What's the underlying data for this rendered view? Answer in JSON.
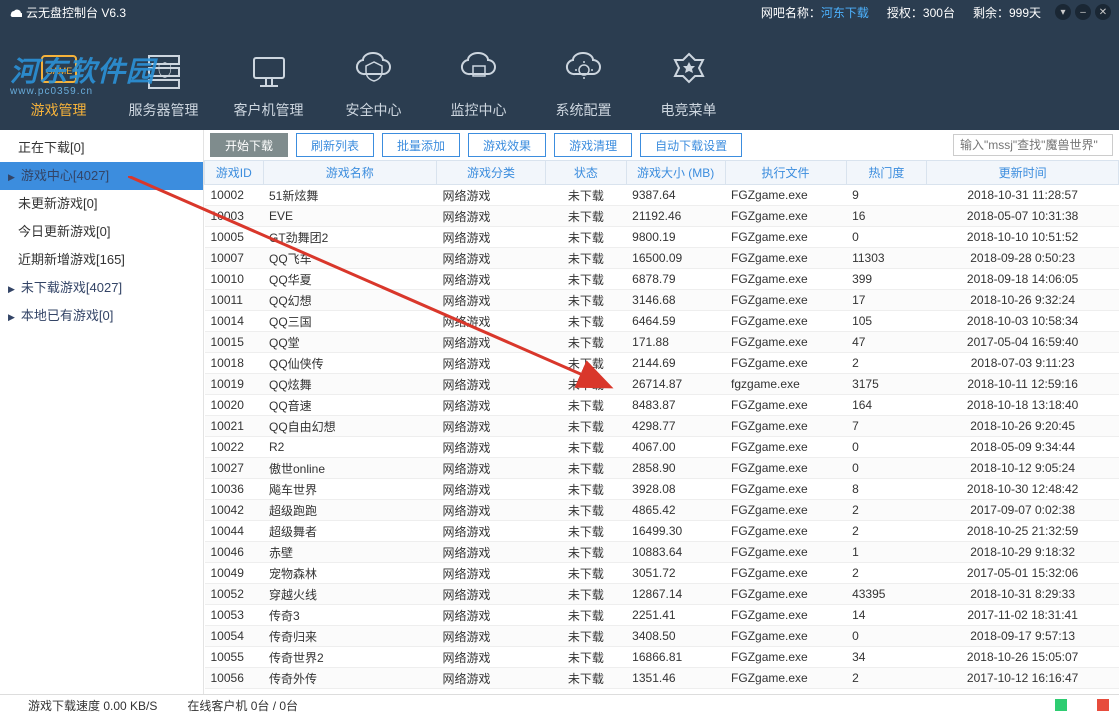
{
  "title": "云无盘控制台 V6.3",
  "header": {
    "bar_label": "网吧名称：",
    "bar_name": "河东下载",
    "auth_label": "授权：",
    "auth_val": "300台",
    "remain_label": "剩余：",
    "remain_val": "999天"
  },
  "nav": [
    {
      "label": "游戏管理",
      "active": true
    },
    {
      "label": "服务器管理"
    },
    {
      "label": "客户机管理"
    },
    {
      "label": "安全中心"
    },
    {
      "label": "监控中心"
    },
    {
      "label": "系统配置"
    },
    {
      "label": "电竞菜单"
    }
  ],
  "sidebar": [
    {
      "label": "正在下载[0]"
    },
    {
      "label": "游戏中心[4027]",
      "sel": true,
      "sub": true
    },
    {
      "label": "未更新游戏[0]"
    },
    {
      "label": "今日更新游戏[0]"
    },
    {
      "label": "近期新增游戏[165]"
    },
    {
      "label": "未下载游戏[4027]",
      "sub": true
    },
    {
      "label": "本地已有游戏[0]",
      "sub": true
    }
  ],
  "toolbar": {
    "start": "开始下载",
    "refresh": "刷新列表",
    "batch": "批量添加",
    "fx": "游戏效果",
    "clean": "游戏清理",
    "auto": "自动下载设置",
    "search_ph": "输入\"mssj\"查找\"魔兽世界\""
  },
  "columns": {
    "id": "游戏ID",
    "name": "游戏名称",
    "cat": "游戏分类",
    "st": "状态",
    "size": "游戏大小 (MB)",
    "exe": "执行文件",
    "hot": "热门度",
    "time": "更新时间"
  },
  "rows": [
    {
      "id": "10002",
      "name": "51新炫舞",
      "cat": "网络游戏",
      "st": "未下载",
      "size": "9387.64",
      "exe": "FGZgame.exe",
      "hot": "9",
      "time": "2018-10-31 11:28:57"
    },
    {
      "id": "10003",
      "name": "EVE",
      "cat": "网络游戏",
      "st": "未下载",
      "size": "21192.46",
      "exe": "FGZgame.exe",
      "hot": "16",
      "time": "2018-05-07 10:31:38"
    },
    {
      "id": "10005",
      "name": "GT劲舞团2",
      "cat": "网络游戏",
      "st": "未下载",
      "size": "9800.19",
      "exe": "FGZgame.exe",
      "hot": "0",
      "time": "2018-10-10 10:51:52"
    },
    {
      "id": "10007",
      "name": "QQ飞车",
      "cat": "网络游戏",
      "st": "未下载",
      "size": "16500.09",
      "exe": "FGZgame.exe",
      "hot": "11303",
      "time": "2018-09-28 0:50:23"
    },
    {
      "id": "10010",
      "name": "QQ华夏",
      "cat": "网络游戏",
      "st": "未下载",
      "size": "6878.79",
      "exe": "FGZgame.exe",
      "hot": "399",
      "time": "2018-09-18 14:06:05"
    },
    {
      "id": "10011",
      "name": "QQ幻想",
      "cat": "网络游戏",
      "st": "未下载",
      "size": "3146.68",
      "exe": "FGZgame.exe",
      "hot": "17",
      "time": "2018-10-26 9:32:24"
    },
    {
      "id": "10014",
      "name": "QQ三国",
      "cat": "网络游戏",
      "st": "未下载",
      "size": "6464.59",
      "exe": "FGZgame.exe",
      "hot": "105",
      "time": "2018-10-03 10:58:34"
    },
    {
      "id": "10015",
      "name": "QQ堂",
      "cat": "网络游戏",
      "st": "未下载",
      "size": "171.88",
      "exe": "FGZgame.exe",
      "hot": "47",
      "time": "2017-05-04 16:59:40"
    },
    {
      "id": "10018",
      "name": "QQ仙侠传",
      "cat": "网络游戏",
      "st": "未下载",
      "size": "2144.69",
      "exe": "FGZgame.exe",
      "hot": "2",
      "time": "2018-07-03 9:11:23"
    },
    {
      "id": "10019",
      "name": "QQ炫舞",
      "cat": "网络游戏",
      "st": "未下载",
      "size": "26714.87",
      "exe": "fgzgame.exe",
      "hot": "3175",
      "time": "2018-10-11 12:59:16"
    },
    {
      "id": "10020",
      "name": "QQ音速",
      "cat": "网络游戏",
      "st": "未下载",
      "size": "8483.87",
      "exe": "FGZgame.exe",
      "hot": "164",
      "time": "2018-10-18 13:18:40"
    },
    {
      "id": "10021",
      "name": "QQ自由幻想",
      "cat": "网络游戏",
      "st": "未下载",
      "size": "4298.77",
      "exe": "FGZgame.exe",
      "hot": "7",
      "time": "2018-10-26 9:20:45"
    },
    {
      "id": "10022",
      "name": "R2",
      "cat": "网络游戏",
      "st": "未下载",
      "size": "4067.00",
      "exe": "FGZgame.exe",
      "hot": "0",
      "time": "2018-05-09 9:34:44"
    },
    {
      "id": "10027",
      "name": "傲世online",
      "cat": "网络游戏",
      "st": "未下载",
      "size": "2858.90",
      "exe": "FGZgame.exe",
      "hot": "0",
      "time": "2018-10-12 9:05:24"
    },
    {
      "id": "10036",
      "name": "飚车世界",
      "cat": "网络游戏",
      "st": "未下载",
      "size": "3928.08",
      "exe": "FGZgame.exe",
      "hot": "8",
      "time": "2018-10-30 12:48:42"
    },
    {
      "id": "10042",
      "name": "超级跑跑",
      "cat": "网络游戏",
      "st": "未下载",
      "size": "4865.42",
      "exe": "FGZgame.exe",
      "hot": "2",
      "time": "2017-09-07 0:02:38"
    },
    {
      "id": "10044",
      "name": "超级舞者",
      "cat": "网络游戏",
      "st": "未下载",
      "size": "16499.30",
      "exe": "FGZgame.exe",
      "hot": "2",
      "time": "2018-10-25 21:32:59"
    },
    {
      "id": "10046",
      "name": "赤壁",
      "cat": "网络游戏",
      "st": "未下载",
      "size": "10883.64",
      "exe": "FGZgame.exe",
      "hot": "1",
      "time": "2018-10-29 9:18:32"
    },
    {
      "id": "10049",
      "name": "宠物森林",
      "cat": "网络游戏",
      "st": "未下载",
      "size": "3051.72",
      "exe": "FGZgame.exe",
      "hot": "2",
      "time": "2017-05-01 15:32:06"
    },
    {
      "id": "10052",
      "name": "穿越火线",
      "cat": "网络游戏",
      "st": "未下载",
      "size": "12867.14",
      "exe": "FGZgame.exe",
      "hot": "43395",
      "time": "2018-10-31 8:29:33"
    },
    {
      "id": "10053",
      "name": "传奇3",
      "cat": "网络游戏",
      "st": "未下载",
      "size": "2251.41",
      "exe": "FGZgame.exe",
      "hot": "14",
      "time": "2017-11-02 18:31:41"
    },
    {
      "id": "10054",
      "name": "传奇归来",
      "cat": "网络游戏",
      "st": "未下载",
      "size": "3408.50",
      "exe": "FGZgame.exe",
      "hot": "0",
      "time": "2018-09-17 9:57:13"
    },
    {
      "id": "10055",
      "name": "传奇世界2",
      "cat": "网络游戏",
      "st": "未下载",
      "size": "16866.81",
      "exe": "FGZgame.exe",
      "hot": "34",
      "time": "2018-10-26 15:05:07"
    },
    {
      "id": "10056",
      "name": "传奇外传",
      "cat": "网络游戏",
      "st": "未下载",
      "size": "1351.46",
      "exe": "FGZgame.exe",
      "hot": "2",
      "time": "2017-10-12 16:16:47"
    }
  ],
  "status": {
    "speed": "游戏下载速度 0.00 KB/S",
    "clients": "在线客户机   0台 / 0台"
  }
}
